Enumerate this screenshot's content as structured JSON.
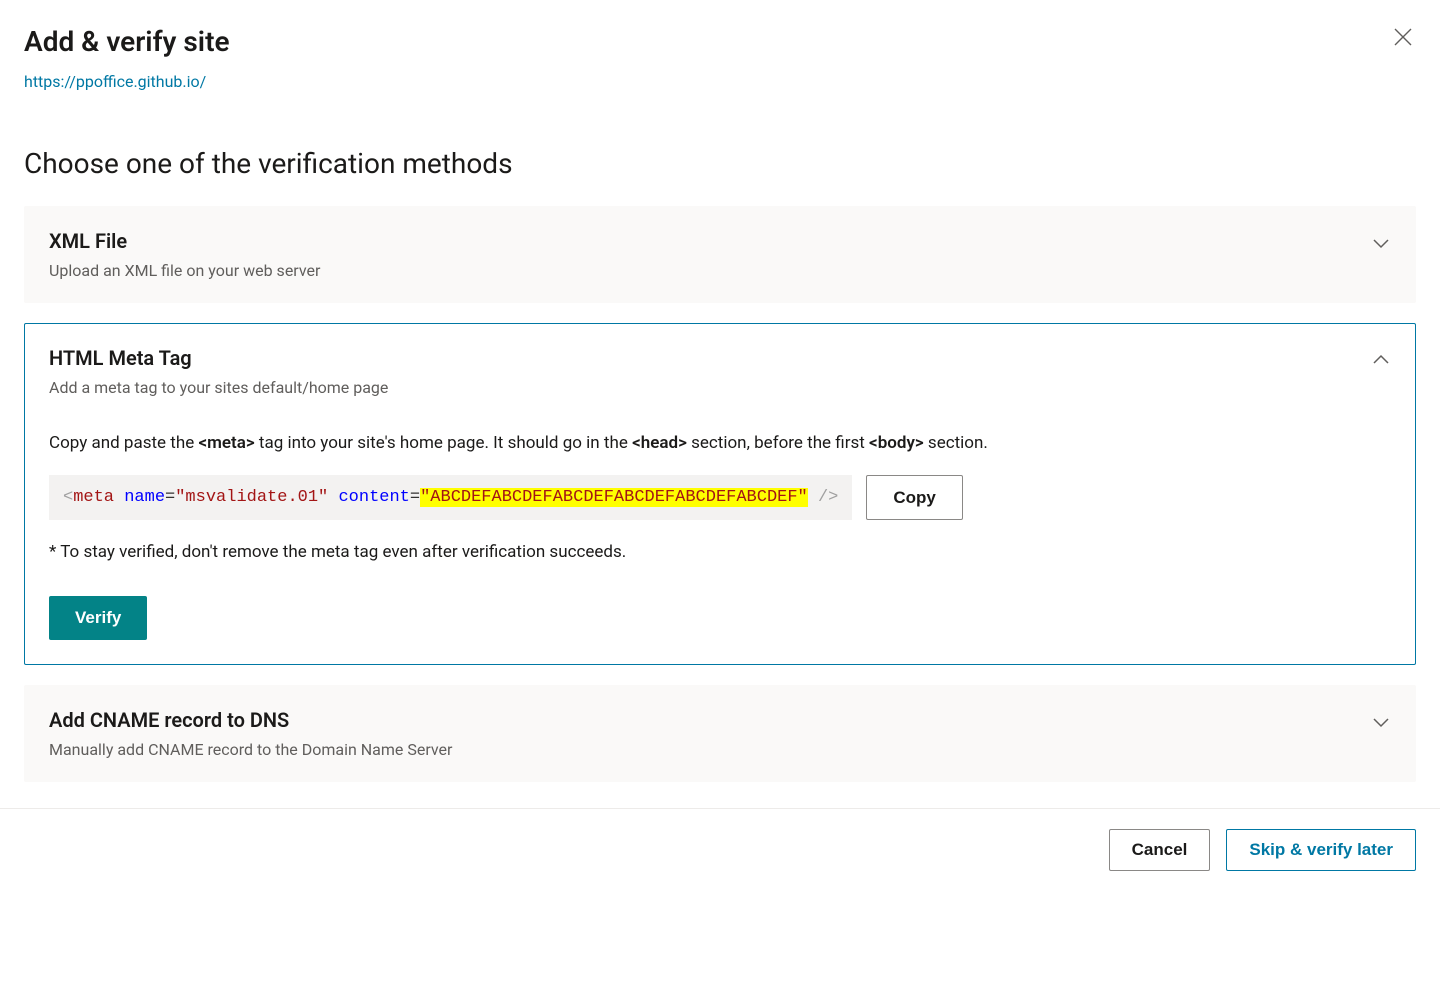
{
  "header": {
    "title": "Add & verify site",
    "site_url": "https://ppoffice.github.io/"
  },
  "section_title": "Choose one of the verification methods",
  "methods": {
    "xml": {
      "title": "XML File",
      "desc": "Upload an XML file on your web server"
    },
    "meta": {
      "title": "HTML Meta Tag",
      "desc": "Add a meta tag to your sites default/home page",
      "instruction_pre": "Copy and paste the ",
      "instruction_tag1": "<meta>",
      "instruction_mid1": " tag into your site's home page. It should go in the ",
      "instruction_tag2": "<head>",
      "instruction_mid2": " section, before the first ",
      "instruction_tag3": "<body>",
      "instruction_post": " section.",
      "code": {
        "open": "<",
        "tag": "meta",
        "sp1": " ",
        "attr1": "name",
        "eq": "=",
        "val1": "\"msvalidate.01\"",
        "sp2": " ",
        "attr2": "content",
        "val2": "\"ABCDEFABCDEFABCDEFABCDEFABCDEFABCDEF\"",
        "close": " />"
      },
      "copy_label": "Copy",
      "note": "* To stay verified, don't remove the meta tag even after verification succeeds.",
      "verify_label": "Verify"
    },
    "cname": {
      "title": "Add CNAME record to DNS",
      "desc": "Manually add CNAME record to the Domain Name Server"
    }
  },
  "footer": {
    "cancel": "Cancel",
    "skip": "Skip & verify later"
  }
}
